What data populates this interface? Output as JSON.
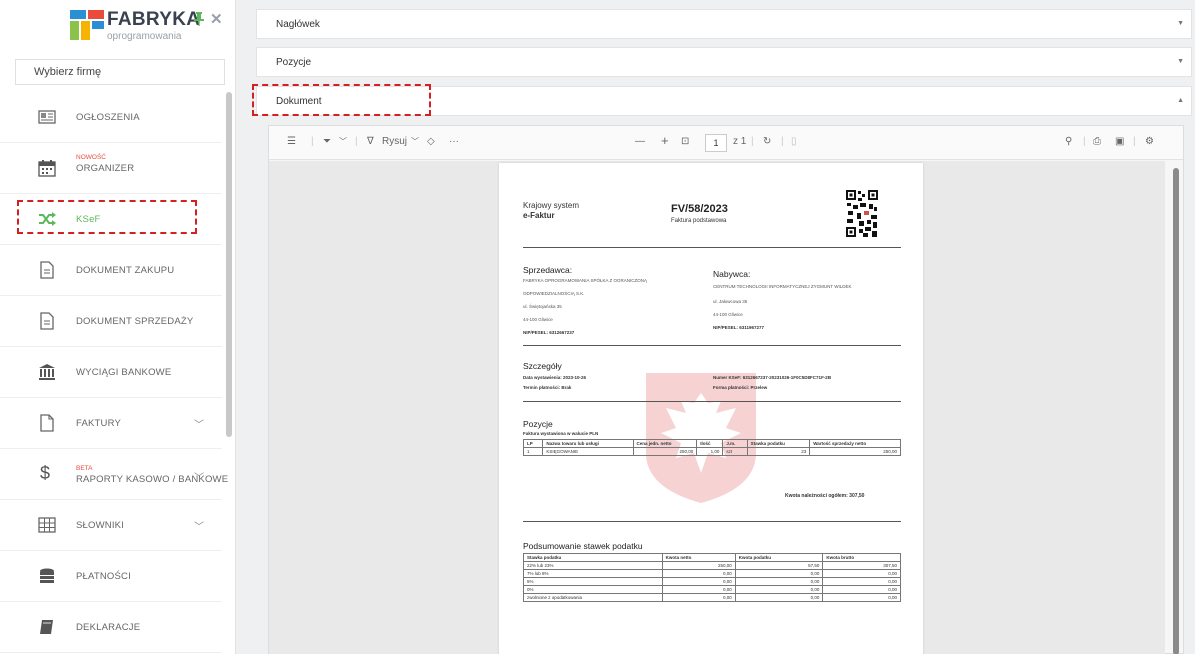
{
  "sidebar": {
    "logo_title": "FABRYKA",
    "logo_subtitle": "oprogramowania",
    "company_select": "Wybierz firmę",
    "items": [
      {
        "label": "OGŁOSZENIA",
        "tag": ""
      },
      {
        "label": "ORGANIZER",
        "tag": "NOWOŚĆ"
      },
      {
        "label": "KSeF",
        "tag": ""
      },
      {
        "label": "DOKUMENT ZAKUPU",
        "tag": ""
      },
      {
        "label": "DOKUMENT SPRZEDAŻY",
        "tag": ""
      },
      {
        "label": "WYCIĄGI BANKOWE",
        "tag": ""
      },
      {
        "label": "FAKTURY",
        "tag": ""
      },
      {
        "label": "RAPORTY KASOWO / BANKOWE",
        "tag": "BETA"
      },
      {
        "label": "SŁOWNIKI",
        "tag": ""
      },
      {
        "label": "PŁATNOŚCI",
        "tag": ""
      },
      {
        "label": "DEKLARACJE",
        "tag": ""
      }
    ]
  },
  "panels": {
    "naglowek": "Nagłówek",
    "pozycje": "Pozycje",
    "dokument": "Dokument"
  },
  "viewer": {
    "draw_label": "Rysuj",
    "page_current": "1",
    "page_total": "z 1"
  },
  "invoice": {
    "system_line1": "Krajowy system",
    "system_line2": "e-Faktur",
    "number": "FV/58/2023",
    "type": "Faktura podstawowa",
    "seller_title": "Sprzedawca:",
    "seller_lines": [
      "FABRYKA OPROGRAMOWANIA SPÓŁKA Z OGRANICZONĄ",
      "ODPOWIEDZIALNOŚCIĄ S.K.",
      "ul. Świętojańska 35",
      "44-100 Gliwice",
      "NIP/PESEL: 6312667237"
    ],
    "buyer_title": "Nabywca:",
    "buyer_lines": [
      "CENTRUM TECHNOLOGII INFORMATYCZNEJ ZYGMUNT WILDEK",
      "ul. Jałowcowa 35",
      "44-100 Gliwice",
      "NIP/PESEL: 6311967277"
    ],
    "details_title": "Szczegóły",
    "details": {
      "issue_date": "Data wystawienia: 2023-10-26",
      "payment_term": "Termin płatności: Brak",
      "ksef_number": "Numer KSeF: 6312667237-20231026-1F0C5D8FC71F-2B",
      "payment_form": "Forma płatności: Przelew"
    },
    "items_title": "Pozycje",
    "items_currency": "Faktura wystawiona w walucie PLN",
    "items_headers": [
      "LP",
      "Nazwa towaru lub usługi",
      "Cena jedn. netto",
      "Ilość",
      "J.m.",
      "Stawka podatku",
      "Wartość sprzedaży netto"
    ],
    "items_rows": [
      [
        "1",
        "KSIĘGOWANIE",
        "250,00",
        "1,00",
        "szt",
        "23",
        "250,00"
      ]
    ],
    "total_due": "Kwota należności ogółem: 307,50",
    "tax_title": "Podsumowanie stawek podatku",
    "tax_headers": [
      "Stawka podatku",
      "Kwota netto",
      "Kwota podatku",
      "Kwota brutto"
    ],
    "tax_rows": [
      [
        "22% lub 23%",
        "250,00",
        "57,50",
        "307,50"
      ],
      [
        "7% lub 8%",
        "0,00",
        "0,00",
        "0,00"
      ],
      [
        "5%",
        "0,00",
        "0,00",
        "0,00"
      ],
      [
        "0%",
        "0,00",
        "0,00",
        "0,00"
      ],
      [
        "zwolnione z opodatkowania",
        "0,00",
        "0,00",
        "0,00"
      ]
    ]
  },
  "colors": {
    "accent_green": "#5cb85c",
    "highlight_red": "#d32020",
    "tag_red": "#e94b3c"
  }
}
